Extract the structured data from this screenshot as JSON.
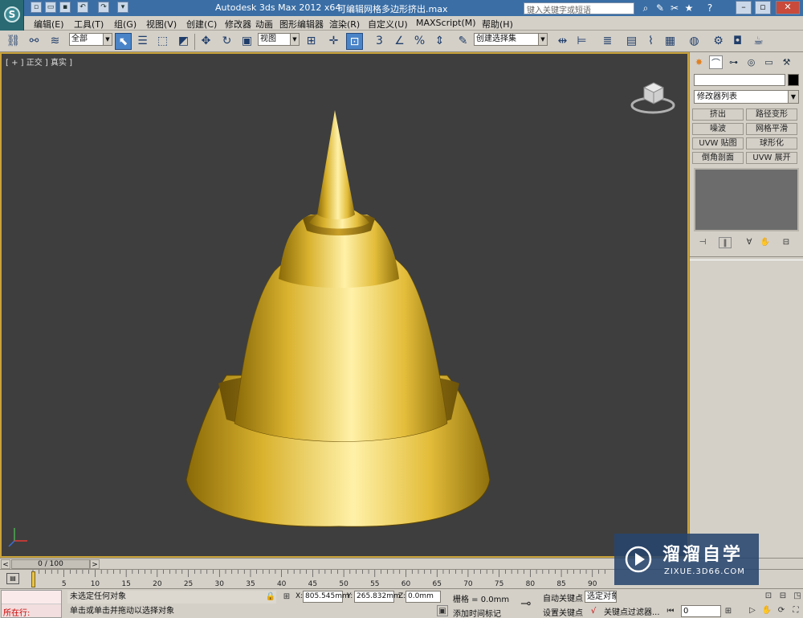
{
  "titlebar": {
    "app_title": "Autodesk 3ds Max  2012 x64",
    "file_title": "可编辑网格多边形挤出.max",
    "search_placeholder": "键入关键字或短语",
    "help_glyph": "?"
  },
  "menu": [
    "编辑(E)",
    "工具(T)",
    "组(G)",
    "视图(V)",
    "创建(C)",
    "修改器",
    "动画",
    "图形编辑器",
    "渲染(R)",
    "自定义(U)",
    "MAXScript(M)",
    "帮助(H)"
  ],
  "toolbar": {
    "selection_filter": "全部",
    "reference_coord": "视图",
    "named_selection": "创建选择集"
  },
  "viewport": {
    "label": "[ + ] 正交 ] 真实 ]",
    "background_color": "#3e3e3e",
    "border_color": "#c8a23a",
    "model_color": "#e6c23c"
  },
  "command_panel": {
    "modifier_list": "修改器列表",
    "modifier_buttons": [
      "挤出",
      "路径变形",
      "噪波",
      "网格平滑",
      "UVW 贴图",
      "球形化",
      "倒角剖面",
      "UVW 展开"
    ]
  },
  "timeline": {
    "frame_range": "0 / 100",
    "ticks": [
      "0",
      "5",
      "10",
      "15",
      "20",
      "25",
      "30",
      "35",
      "40",
      "45",
      "50",
      "55",
      "60",
      "65",
      "70",
      "75",
      "80",
      "85",
      "90"
    ]
  },
  "status": {
    "maxscript_label": "所在行:",
    "selection_status": "未选定任何对象",
    "prompt": "单击或单击并拖动以选择对象",
    "x_label": "X:",
    "x_value": "805.545mm",
    "y_label": "Y:",
    "y_value": "265.832mm",
    "z_label": "Z:",
    "z_value": "0.0mm",
    "grid": "栅格 = 0.0mm",
    "add_time_tag": "添加时间标记",
    "auto_key": "自动关键点",
    "set_key": "设置关键点",
    "selected_dropdown": "选定对象",
    "key_filters": "关键点过滤器...",
    "current_frame": "0"
  },
  "watermark": {
    "title": "溜溜自学",
    "url": "ZIXUE.3D66.COM"
  }
}
